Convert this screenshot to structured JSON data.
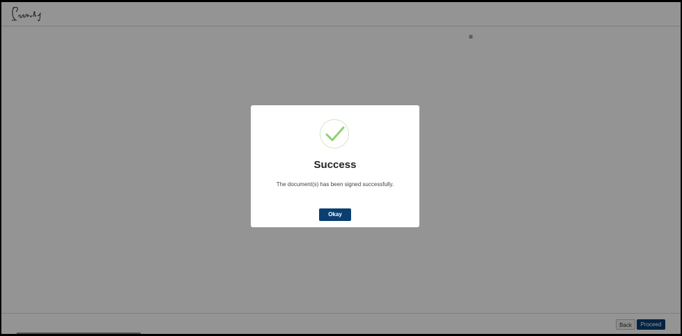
{
  "header": {
    "logo_alt": "Leegality"
  },
  "menu_icon": "hamburger-menu-icon",
  "footer": {
    "back_label": "Back",
    "proceed_label": "Proceed"
  },
  "modal": {
    "icon": "check-icon",
    "title": "Success",
    "message": "The document(s) has been signed successfully.",
    "okay_label": "Okay"
  },
  "colors": {
    "primary": "#0a3f72",
    "success_check": "#8fd16f",
    "overlay": "rgba(0,0,0,0.42)"
  }
}
